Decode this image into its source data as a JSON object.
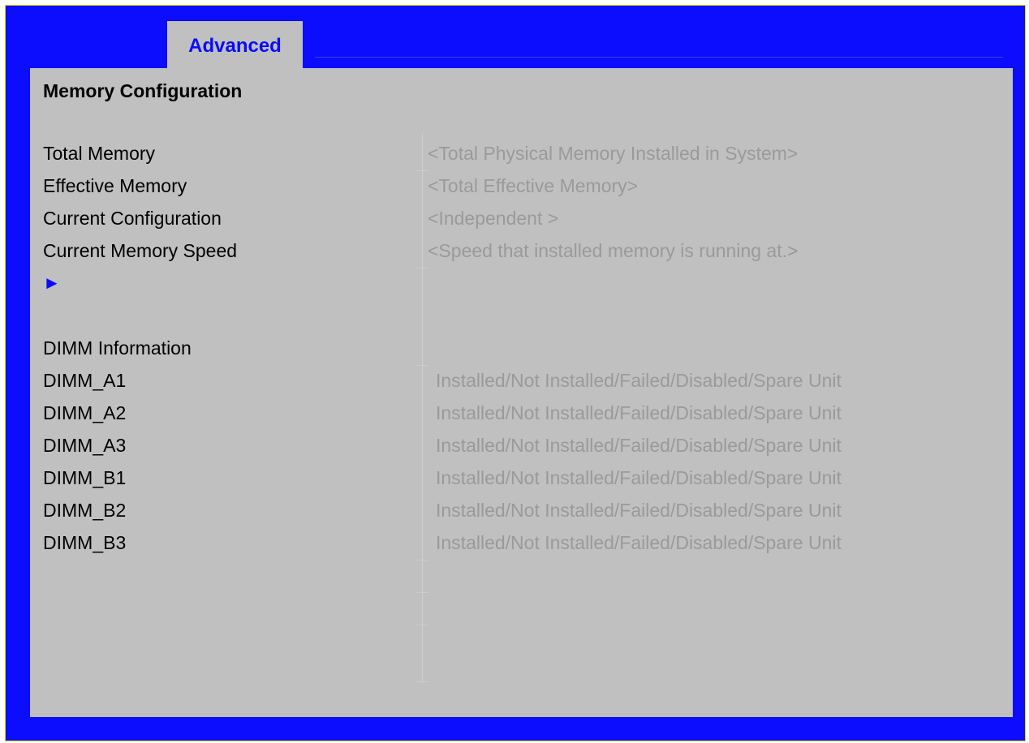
{
  "tab": {
    "label": "Advanced"
  },
  "section": {
    "title": "Memory Configuration"
  },
  "memory_info": [
    {
      "label": "Total Memory",
      "value": "<Total Physical Memory Installed in System>"
    },
    {
      "label": "Effective Memory",
      "value": "<Total Effective Memory>"
    },
    {
      "label": "Current Configuration",
      "value": "<Independent >"
    },
    {
      "label": "Current Memory Speed",
      "value": "<Speed that installed memory is running at.>"
    }
  ],
  "submenu": {
    "arrow": "►"
  },
  "dimm": {
    "header": "DIMM Information",
    "items": [
      {
        "label": "DIMM_A1",
        "value": "Installed/Not Installed/Failed/Disabled/Spare Unit"
      },
      {
        "label": "DIMM_A2",
        "value": "Installed/Not Installed/Failed/Disabled/Spare Unit"
      },
      {
        "label": "DIMM_A3",
        "value": "Installed/Not Installed/Failed/Disabled/Spare Unit"
      },
      {
        "label": "DIMM_B1",
        "value": "Installed/Not Installed/Failed/Disabled/Spare Unit"
      },
      {
        "label": "DIMM_B2",
        "value": "Installed/Not Installed/Failed/Disabled/Spare Unit"
      },
      {
        "label": "DIMM_B3",
        "value": "Installed/Not Installed/Failed/Disabled/Spare Unit"
      }
    ]
  },
  "colors": {
    "frame": "#0c0cff",
    "panel": "#c0c0c0",
    "accent": "#0b0bff",
    "value_text": "#9a9a9a"
  }
}
